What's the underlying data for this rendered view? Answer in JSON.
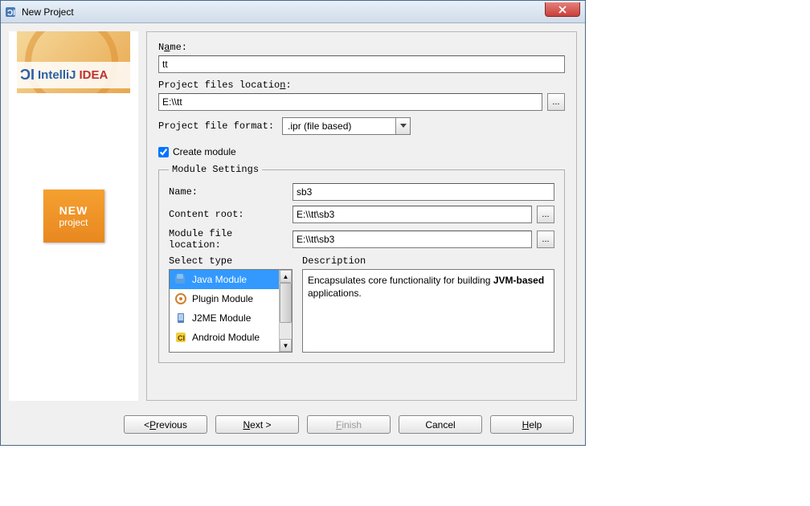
{
  "window": {
    "title": "New Project",
    "close_label": "X"
  },
  "sidebar": {
    "logo_mark": "ϽI",
    "logo_text1": "IntelliJ",
    "logo_text2": "IDEA",
    "badge_line1": "NEW",
    "badge_line2": "project"
  },
  "main": {
    "name_label_pre": "N",
    "name_label_u": "a",
    "name_label_post": "me:",
    "name_value": "tt",
    "location_label_pre": "Project files locatio",
    "location_label_u": "n",
    "location_label_post": ":",
    "location_value": "E:\\\\tt",
    "browse_label": "...",
    "format_label": "Project file format:",
    "format_value": ".ipr (file based)",
    "create_module_label_pre": "",
    "create_module_label_u": "C",
    "create_module_label_post": "reate module",
    "create_module_checked": true
  },
  "module": {
    "legend": "Module Settings",
    "name_label_pre": "Na",
    "name_label_u": "m",
    "name_label_post": "e:",
    "name_value": "sb3",
    "content_root_label_pre": "Content roo",
    "content_root_label_u": "t",
    "content_root_label_post": ":",
    "content_root_value": "E:\\\\tt\\sb3",
    "file_loc_label_pre": "Module ",
    "file_loc_label_u": "f",
    "file_loc_label_post": "ile location:",
    "file_loc_value": "E:\\\\tt\\sb3",
    "select_type_label": "Select type",
    "description_label": "Description",
    "types": [
      {
        "label": "Java Module",
        "selected": true
      },
      {
        "label": "Plugin Module",
        "selected": false
      },
      {
        "label": "J2ME Module",
        "selected": false
      },
      {
        "label": "Android Module",
        "selected": false
      }
    ],
    "description_text_pre": "Encapsulates core functionality for building ",
    "description_text_bold": "JVM-based",
    "description_text_post": " applications."
  },
  "buttons": {
    "previous_pre": "< ",
    "previous_u": "P",
    "previous_post": "revious",
    "next_pre": "",
    "next_u": "N",
    "next_post": "ext >",
    "finish_pre": "",
    "finish_u": "F",
    "finish_post": "inish",
    "cancel": "Cancel",
    "help_pre": "",
    "help_u": "H",
    "help_post": "elp"
  }
}
